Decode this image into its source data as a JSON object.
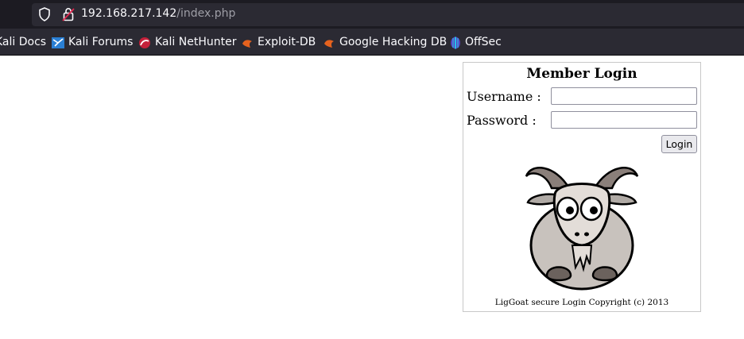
{
  "browser": {
    "url_host": "192.168.217.142",
    "url_path": "/index.php",
    "bookmarks": [
      {
        "label": "Kali Docs",
        "icon": "kali-dragon-icon"
      },
      {
        "label": "Kali Forums",
        "icon": "kali-forums-icon"
      },
      {
        "label": "Kali NetHunter",
        "icon": "nethunter-icon"
      },
      {
        "label": "Exploit-DB",
        "icon": "exploit-db-icon"
      },
      {
        "label": "Google Hacking DB",
        "icon": "ghdb-icon"
      },
      {
        "label": "OffSec",
        "icon": "offsec-icon"
      }
    ]
  },
  "login": {
    "title": "Member Login",
    "username_label": "Username  :",
    "password_label": "Password   :",
    "username_value": "",
    "password_value": "",
    "button_label": "Login",
    "footer": "LigGoat secure Login Copyright (c) 2013"
  }
}
